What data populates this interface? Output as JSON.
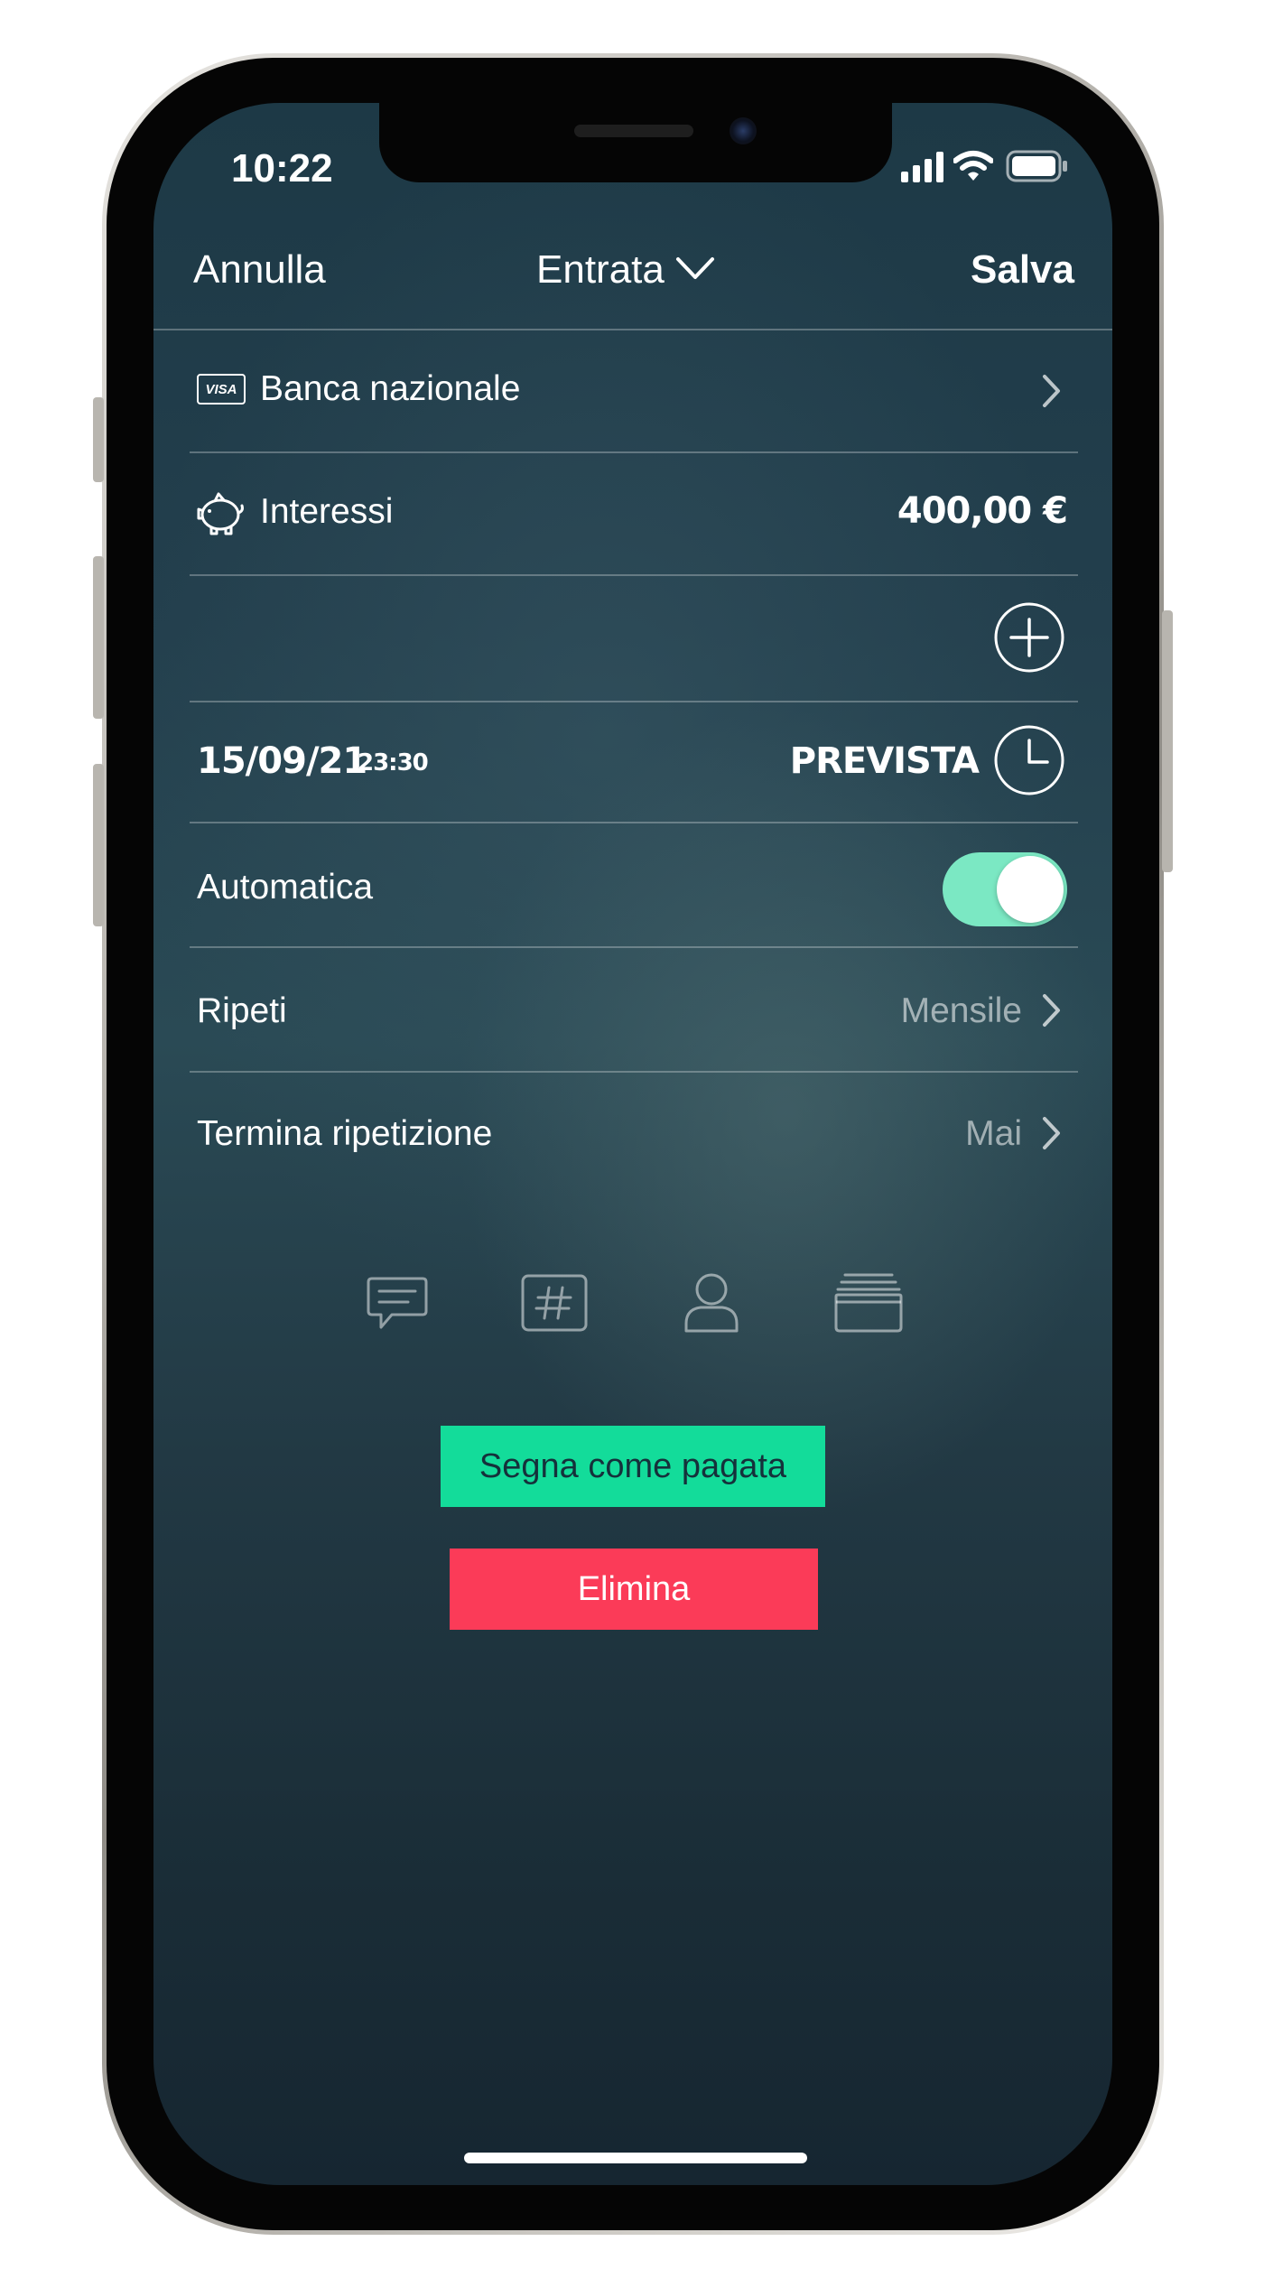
{
  "status_bar": {
    "time": "10:22"
  },
  "nav": {
    "cancel": "Annulla",
    "type": "Entrata",
    "save": "Salva"
  },
  "account": {
    "card_badge": "VISA",
    "name": "Banca nazionale"
  },
  "category": {
    "name": "Interessi",
    "amount": "400,00 €"
  },
  "date": {
    "date": "15/09/21",
    "time": "23:30",
    "status": "PREVISTA"
  },
  "automatic": {
    "label": "Automatica",
    "enabled": true
  },
  "repeat": {
    "label": "Ripeti",
    "value": "Mensile"
  },
  "end_repeat": {
    "label": "Termina ripetizione",
    "value": "Mai"
  },
  "actions": {
    "mark_paid": "Segna come pagata",
    "delete": "Elimina"
  },
  "colors": {
    "accent_green": "#13dc9a",
    "toggle_on": "#7be8c3",
    "delete_red": "#fb3b58"
  }
}
